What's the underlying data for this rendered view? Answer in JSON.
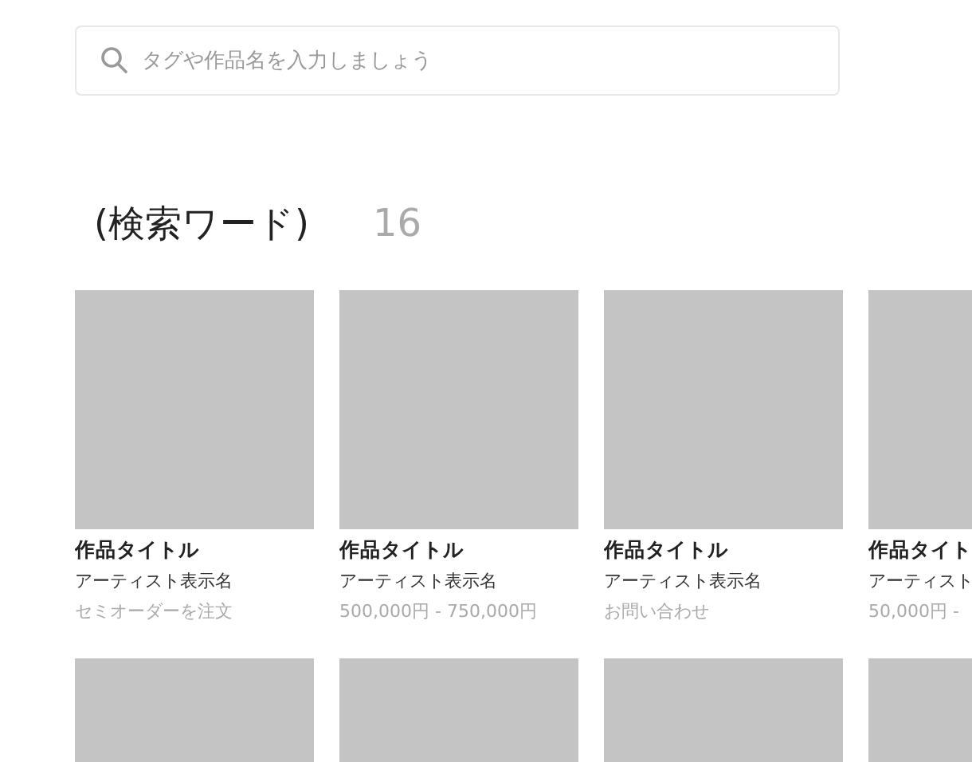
{
  "search": {
    "placeholder": "タグや作品名を入力しましょう"
  },
  "results": {
    "query": "(検索ワード)",
    "count": "16"
  },
  "works": [
    {
      "kind": "full",
      "title": "作品タイトル",
      "artist": "アーティスト表示名",
      "price": "セミオーダーを注文"
    },
    {
      "kind": "full",
      "title": "作品タイトル",
      "artist": "アーティスト表示名",
      "price": "500,000円 - 750,000円"
    },
    {
      "kind": "full",
      "title": "作品タイトル",
      "artist": "アーティスト表示名",
      "price": "お問い合わせ"
    },
    {
      "kind": "full",
      "title": "作品タイト",
      "artist": "アーティスト",
      "price": "50,000円 -"
    },
    {
      "kind": "thumbnail-only"
    },
    {
      "kind": "thumbnail-only"
    },
    {
      "kind": "thumbnail-only"
    },
    {
      "kind": "thumbnail-only"
    }
  ]
}
